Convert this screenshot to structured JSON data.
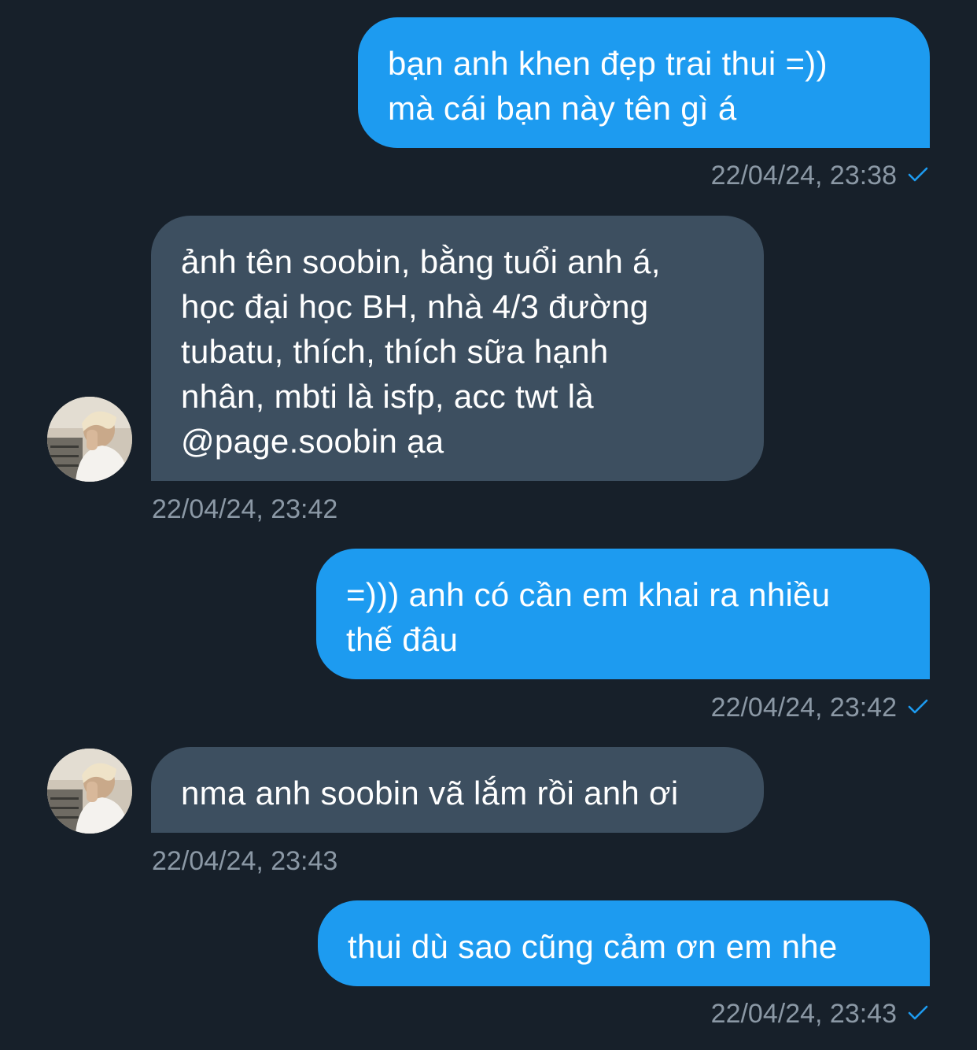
{
  "colors": {
    "background": "#17202a",
    "sent_bubble": "#1d9bf0",
    "received_bubble": "#3d4f60",
    "timestamp": "#8b98a5",
    "check": "#1d9bf0"
  },
  "messages": [
    {
      "direction": "sent",
      "text": "bạn anh khen đẹp trai thui =))\nmà cái bạn này tên gì á",
      "time": "22/04/24, 23:38",
      "status_icon": "check-icon"
    },
    {
      "direction": "received",
      "text": "ảnh tên soobin, bằng tuổi anh á,\nhọc đại học BH, nhà 4/3 đường\ntubatu, thích, thích sữa hạnh\nnhân, mbti là isfp, acc twt là\n@page.soobin ạa",
      "time": "22/04/24, 23:42",
      "avatar_icon": "avatar"
    },
    {
      "direction": "sent",
      "text": "=))) anh có cần em khai ra nhiều\nthế đâu",
      "time": "22/04/24, 23:42",
      "status_icon": "check-icon"
    },
    {
      "direction": "received",
      "text": "nma anh soobin vã lắm rồi anh ơi",
      "time": "22/04/24, 23:43",
      "avatar_icon": "avatar"
    },
    {
      "direction": "sent",
      "text": "thui dù sao cũng cảm ơn em nhe",
      "time": "22/04/24, 23:43",
      "status_icon": "check-icon"
    }
  ]
}
